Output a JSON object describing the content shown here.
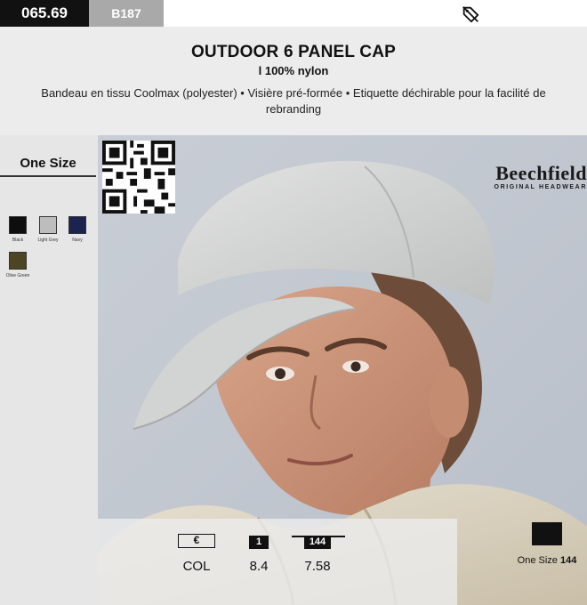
{
  "header": {
    "product_code": "065.69",
    "reference": "B187",
    "promo_icon": "tag-off-icon"
  },
  "product": {
    "title": "OUTDOOR 6 PANEL CAP",
    "subtitle": "l 100% nylon",
    "description": "Bandeau en tissu Coolmax (polyester) • Visière pré-formée • Etiquette déchirable pour la facilité de rebranding"
  },
  "sizes": {
    "label": "One Size"
  },
  "colors": [
    {
      "name": "Black",
      "hex": "#0e0e0e"
    },
    {
      "name": "Light Grey",
      "hex": "#bdbdbd"
    },
    {
      "name": "Navy",
      "hex": "#1c2350"
    },
    {
      "name": "Olive Green",
      "hex": "#4c4422"
    }
  ],
  "brand": {
    "name": "Beechfield",
    "tagline": "ORIGINAL HEADWEAR"
  },
  "pricing": {
    "currency": "€",
    "col_label": "COL",
    "qty_1": "1",
    "qty_2": "144",
    "price_1": "8.4",
    "price_2": "7.58"
  },
  "packaging": {
    "size": "One Size",
    "qty": "144"
  }
}
